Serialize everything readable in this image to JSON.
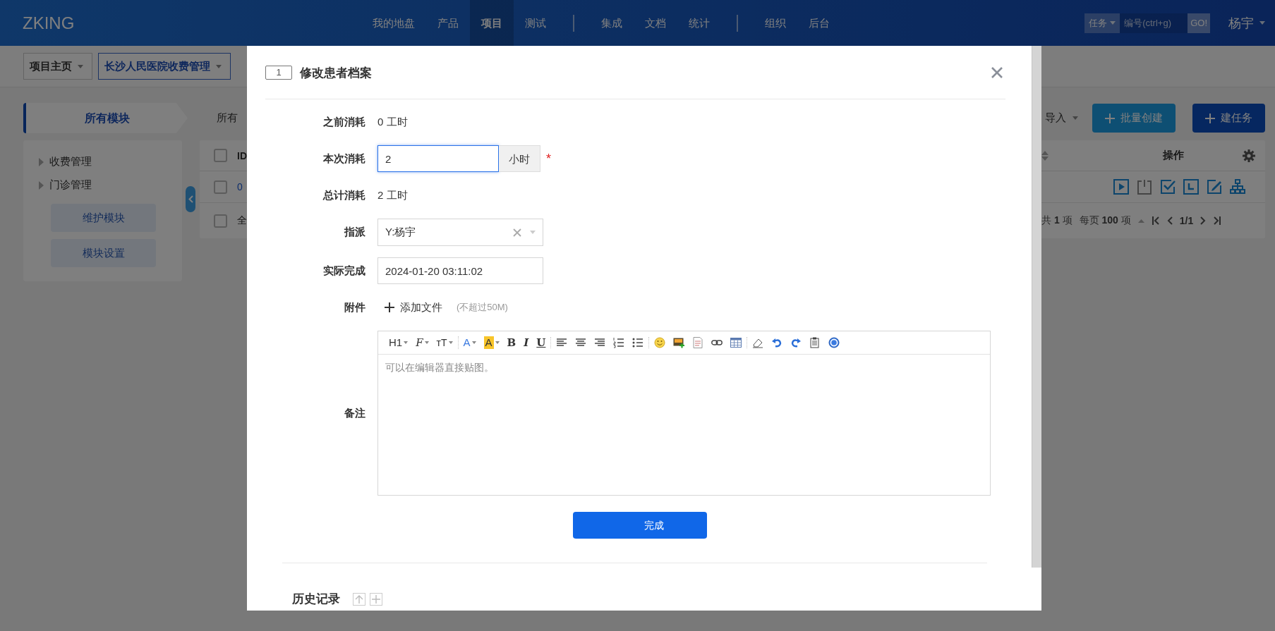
{
  "app": {
    "logo": "ZKING"
  },
  "nav_groups": [
    {
      "items": [
        {
          "label": "我的地盘",
          "selected": false
        },
        {
          "label": "产品",
          "selected": false
        },
        {
          "label": "项目",
          "selected": true
        },
        {
          "label": "测试",
          "selected": false
        }
      ]
    },
    {
      "items": [
        {
          "label": "集成",
          "selected": false
        },
        {
          "label": "文档",
          "selected": false
        },
        {
          "label": "统计",
          "selected": false
        }
      ]
    },
    {
      "items": [
        {
          "label": "组织",
          "selected": false
        },
        {
          "label": "后台",
          "selected": false
        }
      ]
    }
  ],
  "header_right": {
    "object_type": "任务",
    "search_placeholder": "编号(ctrl+g)",
    "go": "GO!",
    "user": "杨宇"
  },
  "breadcrumb": [
    {
      "label": "项目主页"
    },
    {
      "label": "长沙人民医院收费管理"
    }
  ],
  "module_tab": "所有模块",
  "filter_label": "所有",
  "actions": {
    "import": "导入",
    "batch_create": "批量创建",
    "create_task": "建任务"
  },
  "module_tree": [
    {
      "label": "收费管理",
      "expanded": false
    },
    {
      "label": "门诊管理",
      "expanded": false
    }
  ],
  "sidebar_buttons": [
    "维护模块",
    "模块设置"
  ],
  "table": {
    "header_checked": false,
    "row_checked": false,
    "footer_checked": false,
    "id_column": "ID",
    "action_column": "操作",
    "row_id": "0",
    "footer_text": "全",
    "row_actions": [
      {
        "kind": "start",
        "disabled": false
      },
      {
        "kind": "pause",
        "disabled": true
      },
      {
        "kind": "finish",
        "disabled": false
      },
      {
        "kind": "log",
        "disabled": false
      },
      {
        "kind": "edit",
        "disabled": false
      },
      {
        "kind": "tree",
        "disabled": false
      }
    ],
    "pagination": {
      "total": "共 **1** 项",
      "per_page": "每页 **100** 项",
      "page": "1/1"
    }
  },
  "dialog": {
    "id": "1",
    "title": "修改患者档案",
    "fields": [
      {
        "kind": "text",
        "label": "之前消耗",
        "value": "0 工时"
      },
      {
        "kind": "input",
        "label": "本次消耗",
        "value": "2",
        "addon": "小时",
        "required_mark": "*",
        "focused": true
      },
      {
        "kind": "text",
        "label": "总计消耗",
        "value": "2 工时"
      },
      {
        "kind": "select",
        "label": "指派",
        "value": "Y:杨宇"
      },
      {
        "kind": "input",
        "label": "实际完成",
        "value": "2024-01-20 03:11:02",
        "focused": false
      },
      {
        "kind": "attach",
        "label": "附件",
        "action": "添加文件",
        "hint": "(不超过50M)"
      },
      {
        "kind": "editor",
        "label": "备注",
        "placeholder": "可以在编辑器直接贴图。"
      }
    ],
    "toolbar": [
      [
        {
          "kind": "heading",
          "text": "H1"
        },
        {
          "kind": "font",
          "text": "F"
        },
        {
          "kind": "size",
          "text": "тT"
        }
      ],
      [
        {
          "kind": "forecolor",
          "text": "A"
        },
        {
          "kind": "backcolor",
          "text": "A"
        },
        {
          "kind": "bold",
          "text": "B"
        },
        {
          "kind": "italic",
          "text": "I"
        },
        {
          "kind": "underline",
          "text": "U"
        }
      ],
      [
        {
          "kind": "align-left"
        },
        {
          "kind": "align-center"
        },
        {
          "kind": "align-right"
        },
        {
          "kind": "ordered-list"
        },
        {
          "kind": "bullet-list"
        }
      ],
      [
        {
          "kind": "emoji"
        },
        {
          "kind": "image"
        },
        {
          "kind": "code"
        },
        {
          "kind": "link"
        },
        {
          "kind": "table"
        }
      ],
      [
        {
          "kind": "eraser"
        },
        {
          "kind": "undo"
        },
        {
          "kind": "redo"
        },
        {
          "kind": "paste"
        },
        {
          "kind": "help"
        }
      ]
    ],
    "submit": "完成",
    "history": "历史记录"
  }
}
